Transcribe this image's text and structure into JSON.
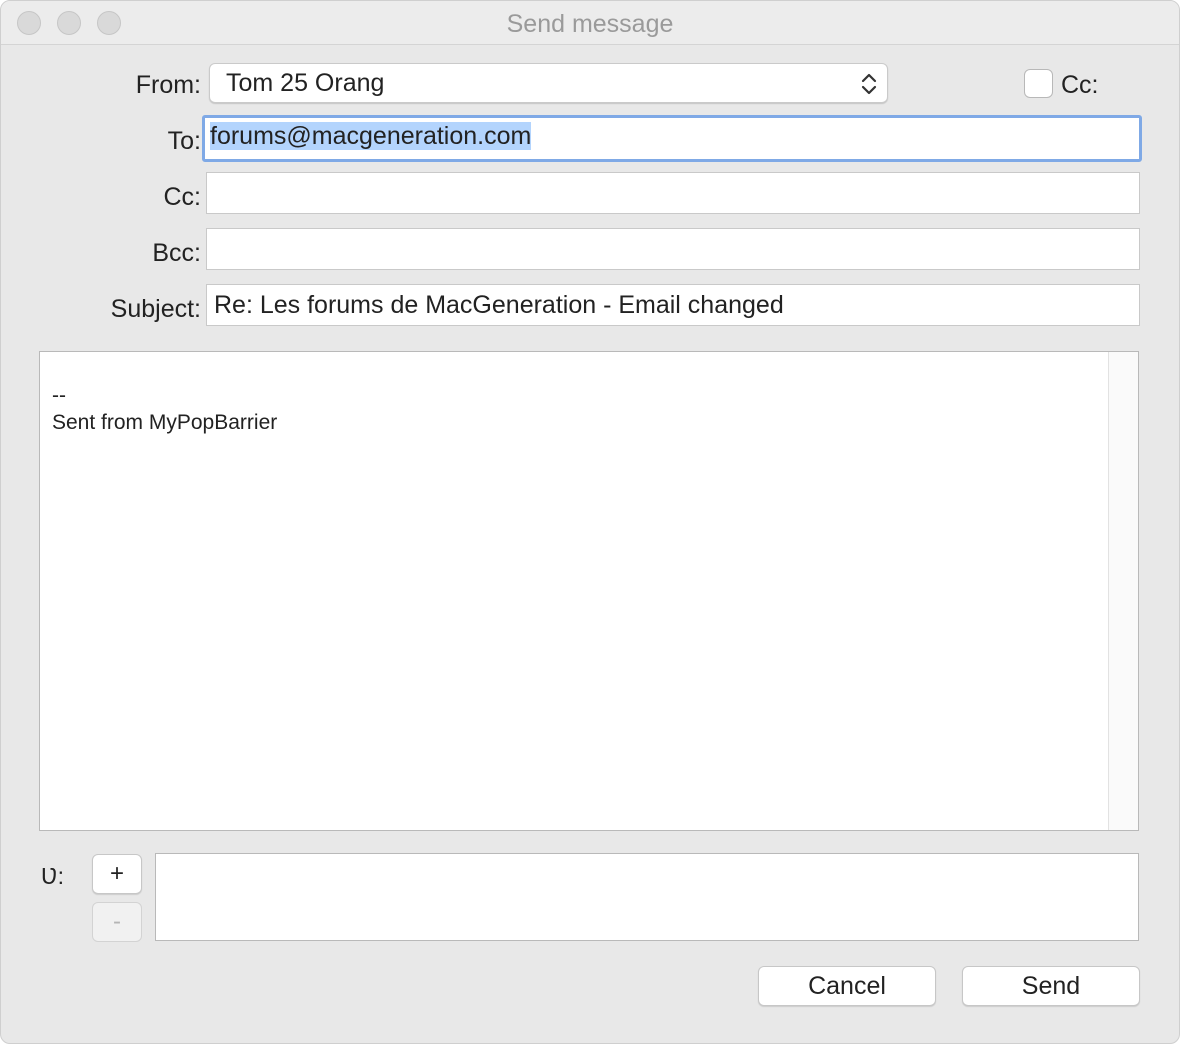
{
  "window": {
    "title": "Send message"
  },
  "form": {
    "from_label": "From:",
    "from_value": "Tom 25 Orang",
    "to_label": "To:",
    "to_value": "forums@macgeneration.com",
    "cc_label": "Cc:",
    "cc_value": "",
    "bcc_label": "Bcc:",
    "bcc_value": "",
    "subject_label": "Subject:",
    "subject_value": "Re: Les forums de MacGeneration - Email changed",
    "cc_checkbox_label": "Cc:",
    "cc_checkbox_checked": false
  },
  "body": {
    "text": "--\nSent from MyPopBarrier"
  },
  "attachments": {
    "label": "Ʋ:",
    "add_label": "+",
    "remove_label": "-"
  },
  "buttons": {
    "cancel_label": "Cancel",
    "send_label": "Send"
  }
}
